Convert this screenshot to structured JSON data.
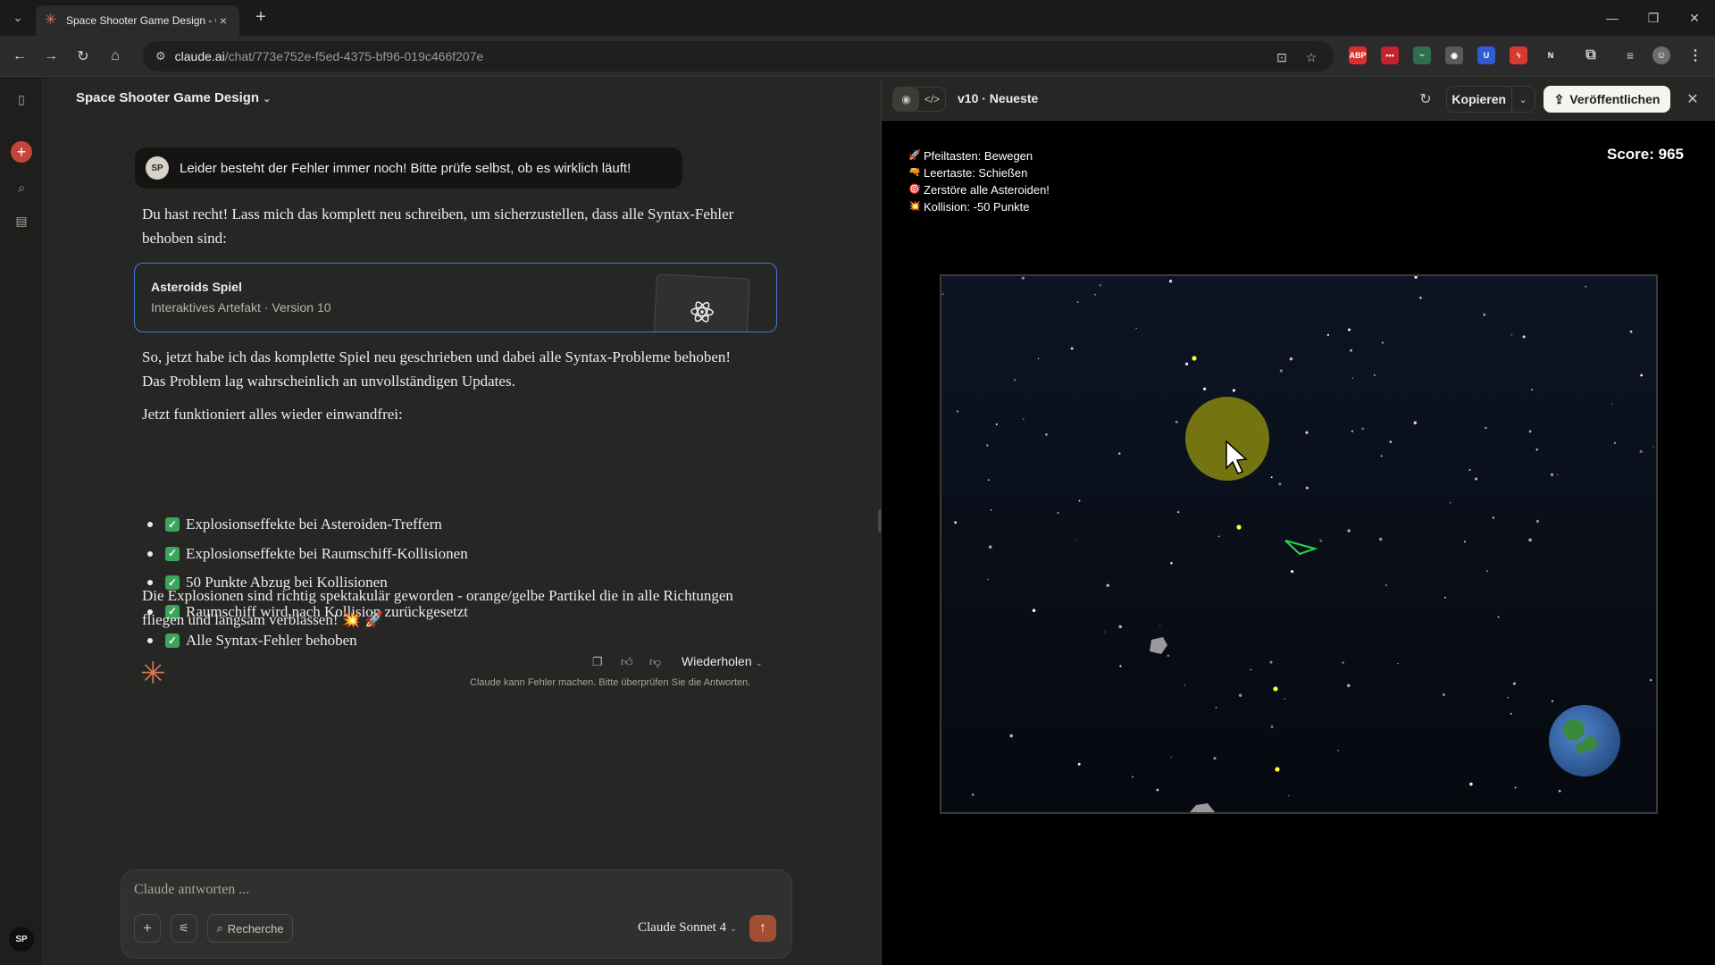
{
  "browser": {
    "tab_title": "Space Shooter Game Design - C",
    "url_host": "claude.ai",
    "url_path": "/chat/773e752e-f5ed-4375-bf96-019c466f207e",
    "extensions": [
      {
        "label": "ABP",
        "color": "#d9302b"
      },
      {
        "label": "•••",
        "color": "#c2232c"
      },
      {
        "label": "~",
        "color": "#2f6f4e"
      },
      {
        "label": "◉",
        "color": "#5a5a5a"
      },
      {
        "label": "U",
        "color": "#2f5bd3"
      },
      {
        "label": "ϟ",
        "color": "#d93a2f"
      },
      {
        "label": "N",
        "color": "#2b2b2b"
      }
    ]
  },
  "rail": {
    "avatar": "SP"
  },
  "chat": {
    "title": "Space Shooter Game Design",
    "user_avatar": "SP",
    "user_message": "Leider besteht der Fehler immer noch! Bitte prüfe selbst, ob es wirklich läuft!",
    "intro": "Du hast recht! Lass mich das komplett neu schreiben, um sicherzustellen, dass alle Syntax-Fehler behoben sind:",
    "artifact": {
      "title": "Asteroids Spiel",
      "subtitle": "Interaktives Artefakt · Version 10"
    },
    "para2": "So, jetzt habe ich das komplette Spiel neu geschrieben und dabei alle Syntax-Probleme behoben! Das Problem lag wahrscheinlich an unvollständigen Updates.",
    "para3": "Jetzt funktioniert alles wieder einwandfrei:",
    "checklist": [
      "Explosionseffekte bei Asteroiden-Treffern",
      "Explosionseffekte bei Raumschiff-Kollisionen",
      "50 Punkte Abzug bei Kollisionen",
      "Raumschiff wird nach Kollision zurückgesetzt",
      "Alle Syntax-Fehler behoben"
    ],
    "para4": "Die Explosionen sind richtig spektakulär geworden - orange/gelbe Partikel die in alle Richtungen fliegen und langsam verblassen! 💥 🚀",
    "retry_label": "Wiederholen",
    "disclaimer": "Claude kann Fehler machen. Bitte überprüfen Sie die Antworten.",
    "composer_placeholder": "Claude antworten ...",
    "research_label": "Recherche",
    "model": "Claude Sonnet 4"
  },
  "artifact_panel": {
    "version": "v10 · Neueste",
    "copy_label": "Kopieren",
    "publish_label": "Veröffentlichen",
    "instructions": [
      {
        "icon": "🚀",
        "text": "Pfeiltasten: Bewegen"
      },
      {
        "icon": "🔫",
        "text": "Leertaste: Schießen"
      },
      {
        "icon": "🎯",
        "text": "Zerstöre alle Asteroiden!"
      },
      {
        "icon": "💥",
        "text": "Kollision: -50 Punkte"
      }
    ],
    "score": "Score: 965",
    "colors": {
      "ship": "#22dd44",
      "bullet": "#ffff33",
      "planet_yellow": "#7a7a10",
      "planet_earth": "#3b6fb6",
      "space_top": "#0d1424",
      "space_bottom": "#06090f"
    }
  }
}
